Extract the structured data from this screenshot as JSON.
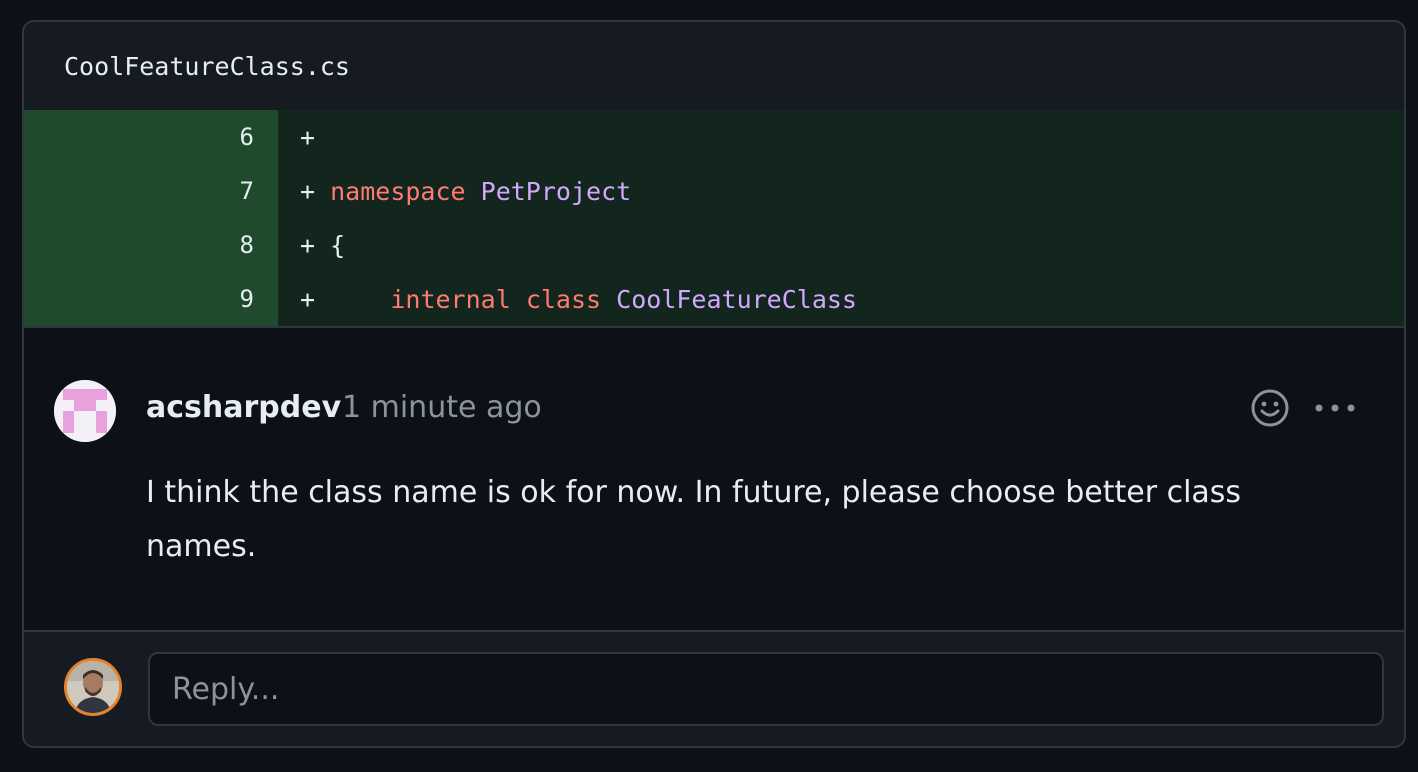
{
  "file": {
    "name": "CoolFeatureClass.cs"
  },
  "diff": {
    "lines": [
      {
        "number": "6",
        "marker": "+"
      },
      {
        "number": "7",
        "marker": "+"
      },
      {
        "number": "8",
        "marker": "+"
      },
      {
        "number": "9",
        "marker": "+"
      }
    ],
    "tokens": {
      "line7_keyword": "namespace",
      "line7_name": "PetProject",
      "line8_brace": "{",
      "line9_indent": "    ",
      "line9_kw1": "internal",
      "line9_kw2": "class",
      "line9_name": "CoolFeatureClass"
    }
  },
  "comment": {
    "author": "acsharpdev",
    "time": "1 minute ago",
    "body": "I think the class name is ok for now. In future, please choose better class names."
  },
  "reply": {
    "placeholder": "Reply..."
  },
  "icons": {
    "emoji": "smiley-icon",
    "more": "kebab-horizontal-icon"
  },
  "colors": {
    "background": "#0d1117",
    "addition_gutter": "#1f4a2b",
    "addition_line": "#12261e",
    "keyword": "#ff7b72",
    "entity": "#d2a8ff",
    "muted": "#8b949e",
    "avatar_ring": "#e5822e"
  }
}
